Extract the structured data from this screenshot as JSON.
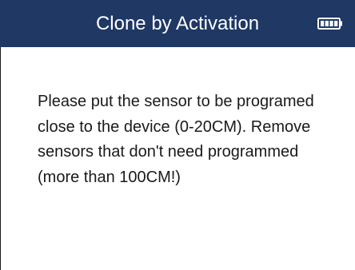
{
  "header": {
    "title": "Clone by Activation",
    "battery_icon": "battery-full-icon",
    "background_color": "#1f3864",
    "text_color": "#ffffff"
  },
  "main": {
    "message": "Please put the sensor to be programed close to the device (0-20CM). Remove sensors that don't need programmed (more than 100CM!)"
  }
}
